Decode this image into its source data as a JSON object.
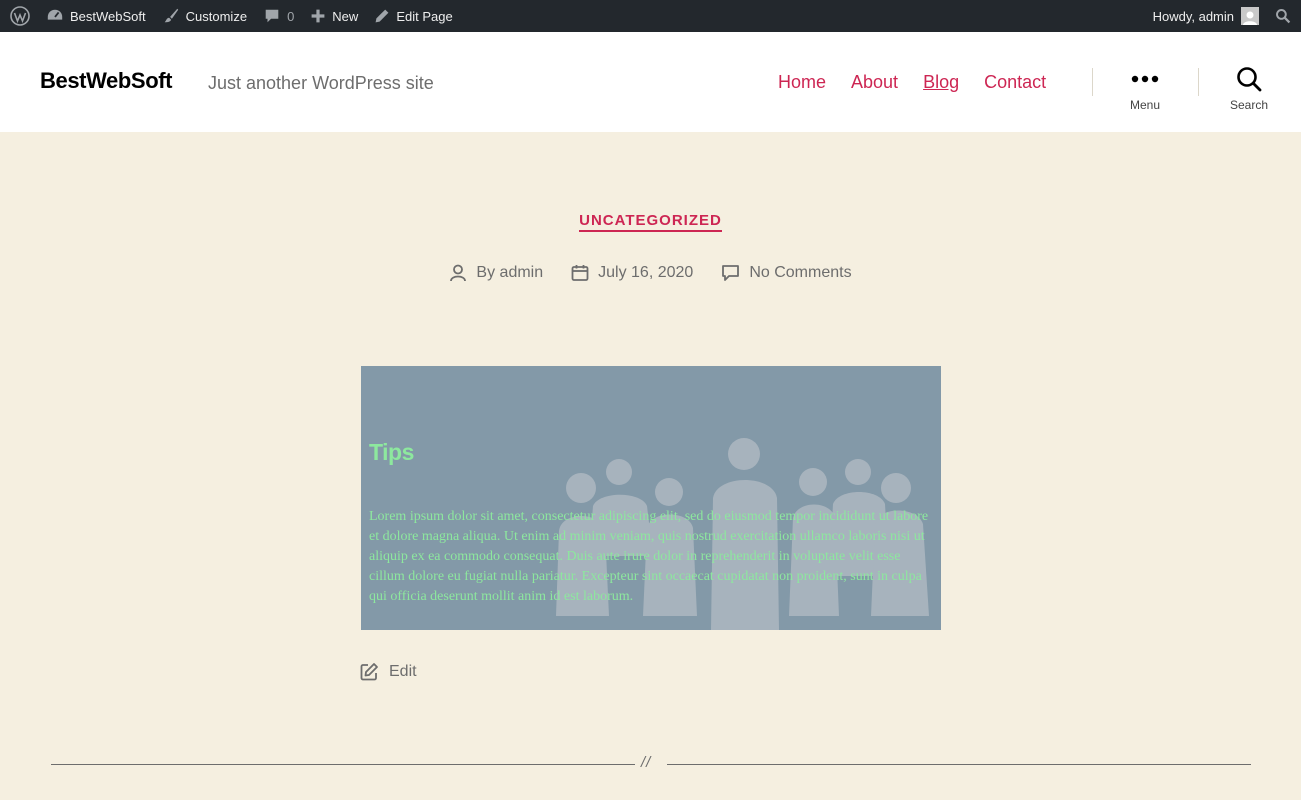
{
  "adminbar": {
    "site_name": "BestWebSoft",
    "customize": "Customize",
    "comments_count": "0",
    "new_label": "New",
    "edit_page": "Edit Page",
    "howdy": "Howdy, admin"
  },
  "header": {
    "site_title": "BestWebSoft",
    "tagline": "Just another WordPress site",
    "nav": [
      "Home",
      "About",
      "Blog",
      "Contact"
    ],
    "current_nav": "Blog",
    "menu_label": "Menu",
    "search_label": "Search"
  },
  "post": {
    "category": "UNCATEGORIZED",
    "author": "By admin",
    "date": "July 16, 2020",
    "comments": "No Comments",
    "cover_title": "Tips",
    "cover_text": "Lorem ipsum dolor sit amet, consectetur adipiscing elit, sed do eiusmod tempor incididunt ut labore et dolore magna aliqua. Ut enim ad minim veniam, quis nostrud exercitation ullamco laboris nisi ut aliquip ex ea commodo consequat. Duis aute irure dolor in reprehenderit in voluptate velit esse cillum dolore eu fugiat nulla pariatur. Excepteur sint occaecat cupidatat non proident, sunt in culpa qui officia deserunt mollit anim id est laborum.",
    "edit_label": "Edit"
  },
  "separator": "//",
  "colors": {
    "accent": "#cd2653",
    "background": "#f5efe0",
    "adminbar": "#23282d",
    "cover_bg": "#8399a8",
    "cover_text": "#8de89e"
  }
}
